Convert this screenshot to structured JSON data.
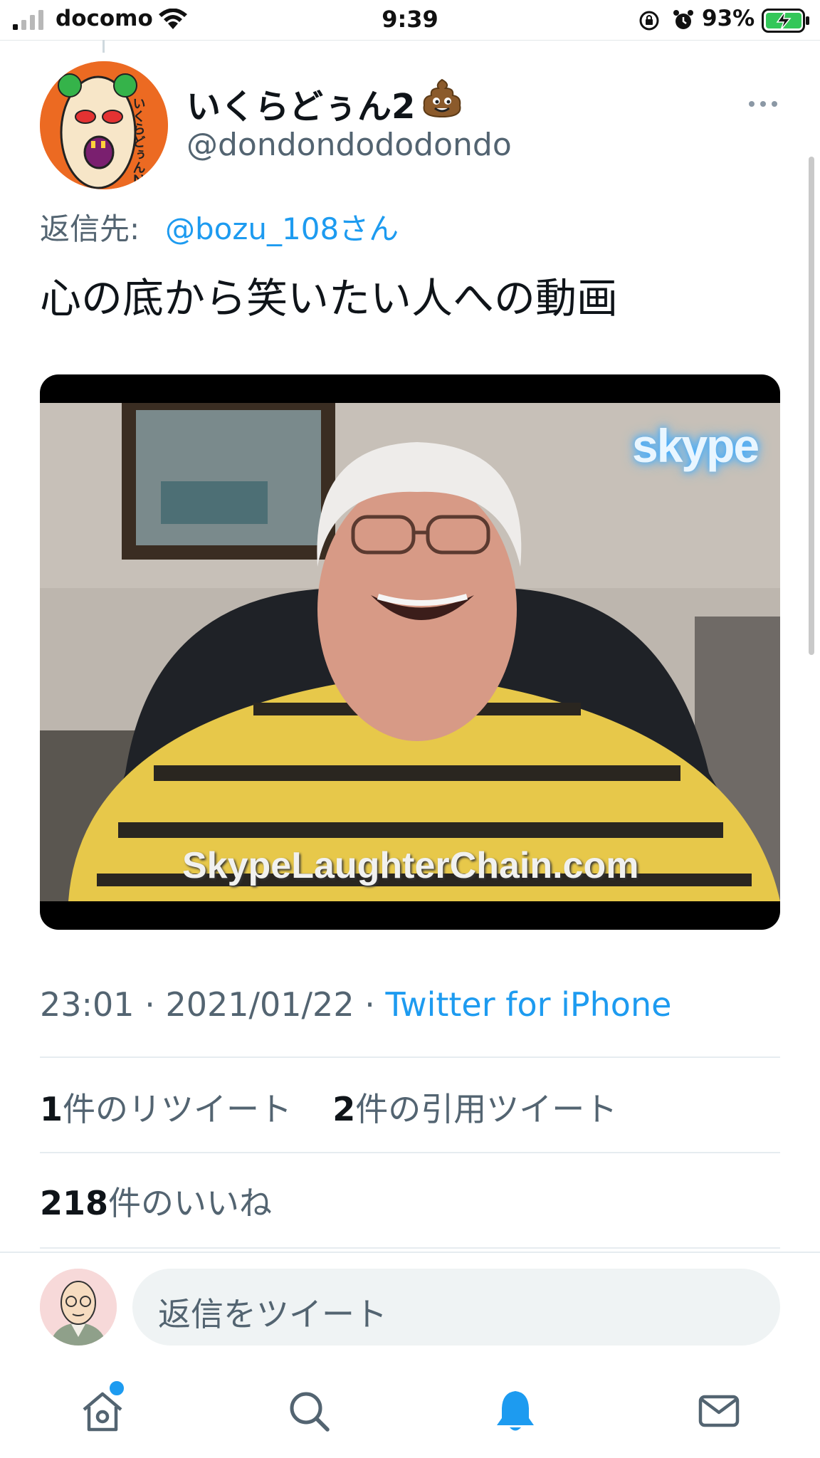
{
  "status_bar": {
    "carrier": "docomo",
    "time": "9:39",
    "battery_percent": "93%"
  },
  "tweet": {
    "author_name": "いくらどぅん2",
    "author_emoji": "poop-emoji",
    "author_handle": "@dondondododondo",
    "reply_prefix": "返信先:",
    "reply_target": "@bozu_108さん",
    "text": "心の底から笑いたい人への動画",
    "media": {
      "brand_text": "skype",
      "caption_text": "SkypeLaughterChain.com"
    },
    "time": "23:01",
    "separator": "·",
    "date": "2021/01/22",
    "source": "Twitter for iPhone",
    "retweet_count": "1",
    "retweet_label": "件のリツイート",
    "quote_count": "2",
    "quote_label": "件の引用ツイート",
    "like_count": "218",
    "like_label": "件のいいね"
  },
  "composer": {
    "placeholder": "返信をツイート"
  },
  "tab_bar": {
    "items": [
      "home-icon",
      "search-icon",
      "notifications-icon",
      "messages-icon"
    ],
    "active": "notifications-icon"
  },
  "colors": {
    "accent": "#1d9bf0",
    "secondary_text": "#536471"
  }
}
